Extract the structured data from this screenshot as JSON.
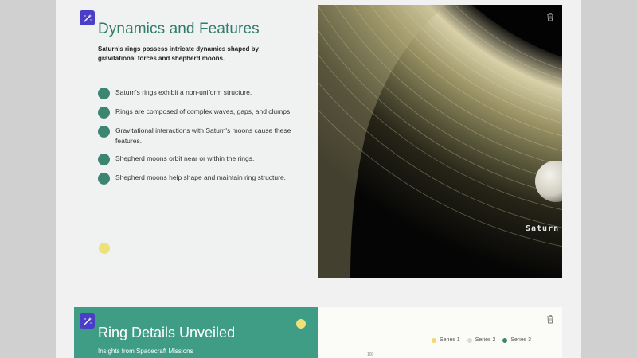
{
  "slide1": {
    "title": "Dynamics and Features",
    "subtitle": "Saturn's rings possess intricate dynamics shaped by gravitational forces and shepherd moons.",
    "bullets": [
      "Saturn's rings exhibit a non-uniform structure.",
      "Rings are composed of complex waves, gaps, and clumps.",
      "Gravitational interactions with Saturn's moons cause these features.",
      "Shepherd moons orbit near or within the rings.",
      "Shepherd moons help shape and maintain ring structure."
    ],
    "image_caption": "Saturn R",
    "colors": {
      "title": "#2f7d6a",
      "bullet_dot": "#3b8571",
      "accent_dot": "#ede27a"
    }
  },
  "slide2": {
    "title": "Ring Details Unveiled",
    "subtitle": "Insights from Spacecraft Missions",
    "legend": [
      {
        "label": "Series 1",
        "color": "#f2d86e"
      },
      {
        "label": "Series 2",
        "color": "#d9d9d9"
      },
      {
        "label": "Series 3",
        "color": "#3b8571"
      }
    ],
    "axis_top_label": "100",
    "colors": {
      "panel": "#3f9d86",
      "accent_dot": "#ede27a"
    }
  },
  "icons": {
    "magic": "magic-wand-icon",
    "delete": "trash-icon"
  }
}
